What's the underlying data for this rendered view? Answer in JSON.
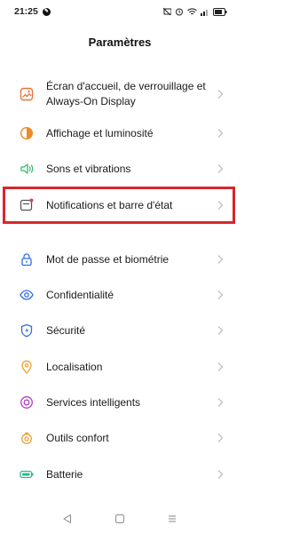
{
  "status_bar": {
    "time": "21:25",
    "app_icon": "notification-app-icon",
    "icons": [
      "mute-icon",
      "alarm-icon",
      "wifi-icon",
      "signal-icon",
      "battery-icon"
    ]
  },
  "header": {
    "title": "Paramètres"
  },
  "items": [
    {
      "label": "Écran d'accueil, de verrouillage et Always-On Display",
      "icon": "wallpaper-icon",
      "color": "#e8743b"
    },
    {
      "label": "Affichage et luminosité",
      "icon": "brightness-icon",
      "color": "#f08a24"
    },
    {
      "label": "Sons et vibrations",
      "icon": "sound-icon",
      "color": "#3cb371"
    },
    {
      "label": "Notifications et barre d'état",
      "icon": "notification-icon",
      "color": "#7a3ec7"
    },
    {
      "label": "Mot de passe et biométrie",
      "icon": "lock-icon",
      "color": "#2f6fe0"
    },
    {
      "label": "Confidentialité",
      "icon": "privacy-eye-icon",
      "color": "#2f6fe0"
    },
    {
      "label": "Sécurité",
      "icon": "security-shield-icon",
      "color": "#2f6fe0"
    },
    {
      "label": "Localisation",
      "icon": "location-pin-icon",
      "color": "#f0a030"
    },
    {
      "label": "Services intelligents",
      "icon": "smart-services-icon",
      "color": "#b03fc7"
    },
    {
      "label": "Outils confort",
      "icon": "convenience-tools-icon",
      "color": "#f0a030"
    },
    {
      "label": "Batterie",
      "icon": "battery-settings-icon",
      "color": "#2fb890"
    }
  ],
  "highlight_color": "#d9262c",
  "nav": {
    "icons": [
      "back-icon",
      "home-icon",
      "recents-icon"
    ]
  }
}
